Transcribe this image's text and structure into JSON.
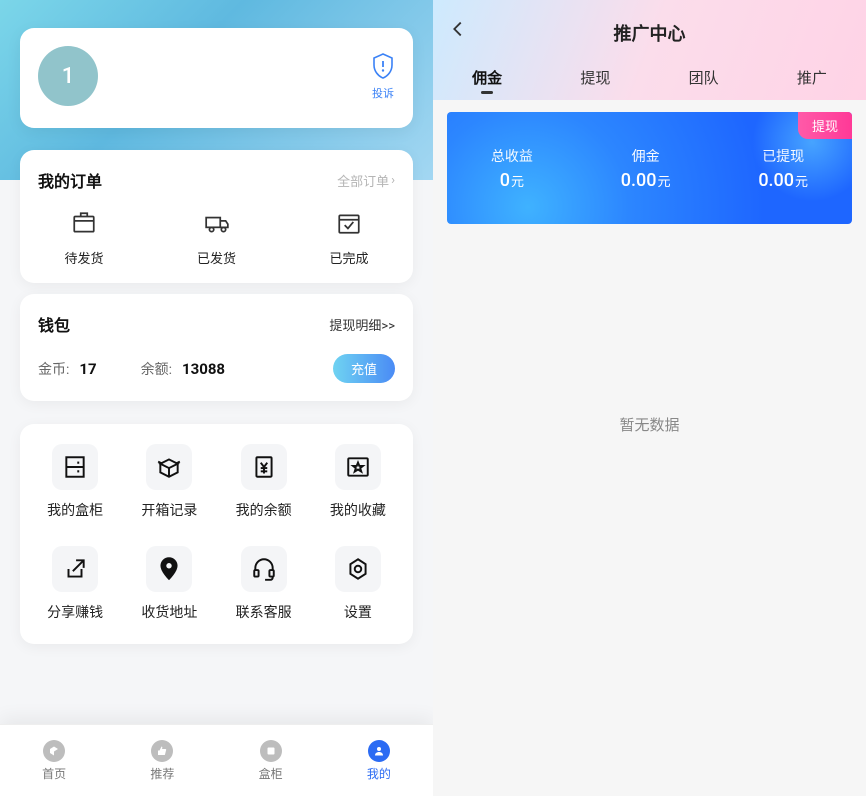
{
  "left": {
    "avatar_text": "1",
    "complaint_label": "投诉",
    "orders": {
      "title": "我的订单",
      "all_label": "全部订单",
      "states": [
        {
          "label": "待发货"
        },
        {
          "label": "已发货"
        },
        {
          "label": "已完成"
        }
      ]
    },
    "wallet": {
      "title": "钱包",
      "more_label": "提现明细>>",
      "coin_label": "金币:",
      "coin_value": "17",
      "balance_label": "余额:",
      "balance_value": "13088",
      "recharge_label": "充值"
    },
    "grid": [
      {
        "label": "我的盒柜"
      },
      {
        "label": "开箱记录"
      },
      {
        "label": "我的余额"
      },
      {
        "label": "我的收藏"
      },
      {
        "label": "分享赚钱"
      },
      {
        "label": "收货地址"
      },
      {
        "label": "联系客服"
      },
      {
        "label": "设置"
      }
    ],
    "tabbar": [
      {
        "label": "首页",
        "active": false
      },
      {
        "label": "推荐",
        "active": false
      },
      {
        "label": "盒柜",
        "active": false
      },
      {
        "label": "我的",
        "active": true
      }
    ]
  },
  "right": {
    "title": "推广中心",
    "tabs": [
      {
        "label": "佣金",
        "active": true
      },
      {
        "label": "提现",
        "active": false
      },
      {
        "label": "团队",
        "active": false
      },
      {
        "label": "推广",
        "active": false
      }
    ],
    "withdraw_tag": "提现",
    "stats": [
      {
        "label": "总收益",
        "value": "0",
        "unit": "元"
      },
      {
        "label": "佣金",
        "value": "0.00",
        "unit": "元"
      },
      {
        "label": "已提现",
        "value": "0.00",
        "unit": "元"
      }
    ],
    "empty_label": "暂无数据"
  }
}
